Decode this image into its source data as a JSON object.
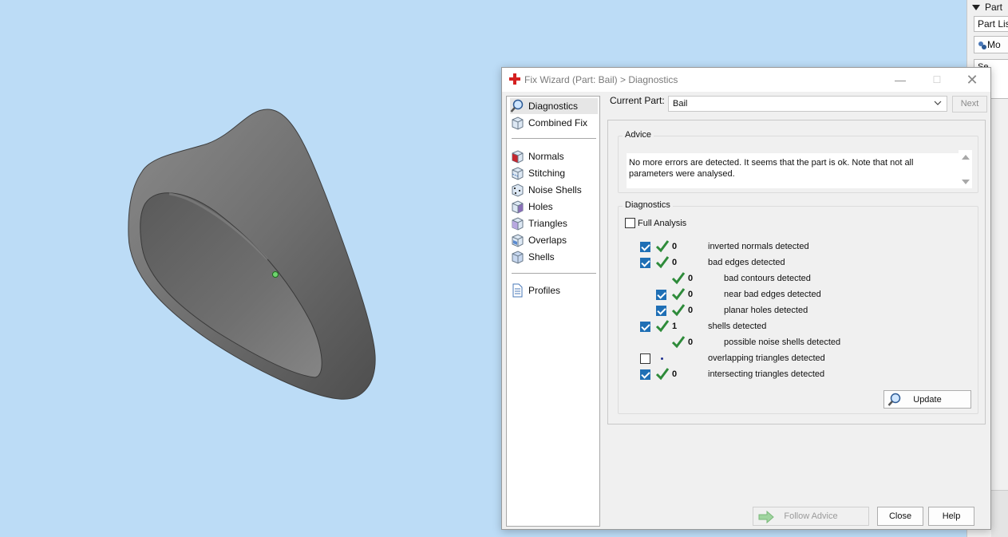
{
  "side_panel": {
    "header_label": "Part",
    "tab_label": "Part Lis",
    "button_label": "Mo",
    "section_label": "Se"
  },
  "dialog": {
    "title": "Fix Wizard (Part: Bail) > Diagnostics",
    "nav": {
      "items": [
        {
          "label": "Diagnostics",
          "icon": "magnifier-icon",
          "selected": true
        },
        {
          "label": "Combined Fix",
          "icon": "cube-icon"
        },
        {
          "label": "Normals",
          "icon": "normals-cube-icon"
        },
        {
          "label": "Stitching",
          "icon": "stitching-cube-icon"
        },
        {
          "label": "Noise Shells",
          "icon": "noise-shells-icon"
        },
        {
          "label": "Holes",
          "icon": "holes-cube-icon"
        },
        {
          "label": "Triangles",
          "icon": "triangles-cube-icon"
        },
        {
          "label": "Overlaps",
          "icon": "overlaps-cube-icon"
        },
        {
          "label": "Shells",
          "icon": "shells-cube-icon"
        },
        {
          "label": "Profiles",
          "icon": "document-icon"
        }
      ]
    },
    "current_part": {
      "label": "Current Part:",
      "value": "Bail"
    },
    "next_label": "Next",
    "advice": {
      "legend": "Advice",
      "text": "No more errors are detected. It seems that the part is ok. Note that not all parameters were analysed."
    },
    "diagnostics": {
      "legend": "Diagnostics",
      "full_analysis_label": "Full Analysis",
      "full_analysis_checked": false,
      "rows": [
        {
          "indent": 0,
          "checkbox": true,
          "checked": true,
          "status": "ok",
          "count": "0",
          "label": "inverted normals detected"
        },
        {
          "indent": 0,
          "checkbox": true,
          "checked": true,
          "status": "ok",
          "count": "0",
          "label": "bad edges detected"
        },
        {
          "indent": 1,
          "checkbox": false,
          "checked": false,
          "status": "ok",
          "count": "0",
          "label": "bad contours detected"
        },
        {
          "indent": 1,
          "checkbox": true,
          "checked": true,
          "status": "ok",
          "count": "0",
          "label": "near bad edges detected"
        },
        {
          "indent": 1,
          "checkbox": true,
          "checked": true,
          "status": "ok",
          "count": "0",
          "label": "planar holes detected"
        },
        {
          "indent": 0,
          "checkbox": true,
          "checked": true,
          "status": "ok",
          "count": "1",
          "label": "shells detected"
        },
        {
          "indent": 1,
          "checkbox": false,
          "checked": false,
          "status": "ok",
          "count": "0",
          "label": "possible noise shells detected"
        },
        {
          "indent": 0,
          "checkbox": true,
          "checked": false,
          "status": "not-run",
          "count": "",
          "label": "overlapping triangles detected"
        },
        {
          "indent": 0,
          "checkbox": true,
          "checked": true,
          "status": "ok",
          "count": "0",
          "label": "intersecting triangles detected"
        }
      ],
      "update_label": "Update"
    },
    "buttons": {
      "follow_advice": "Follow Advice",
      "close": "Close",
      "help": "Help"
    }
  },
  "colors": {
    "viewport_bg": "#bcdcf6",
    "model_gray": "#6e6e6e",
    "check_green": "#2e8b3a",
    "checkbox_blue": "#1f6fb5"
  }
}
